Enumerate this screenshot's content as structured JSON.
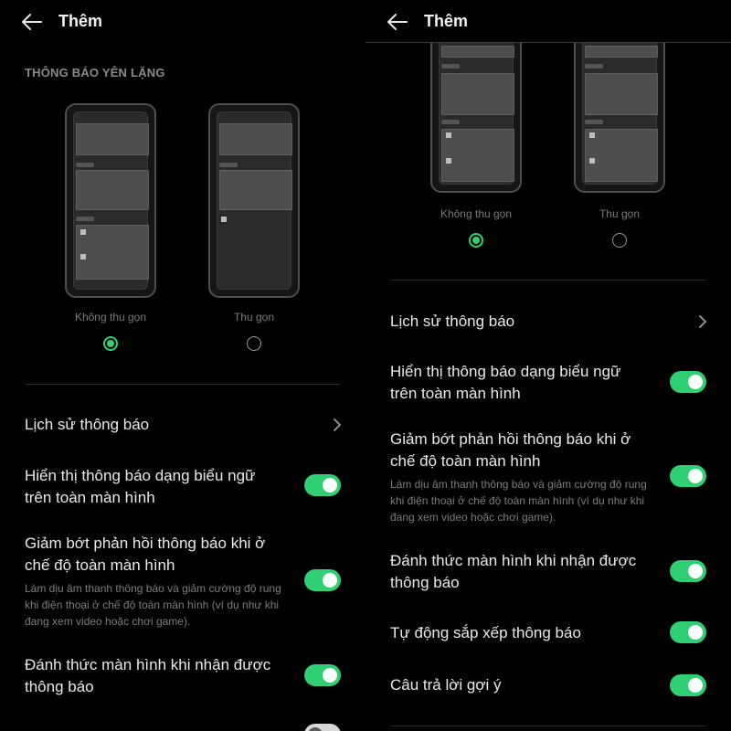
{
  "left": {
    "header": {
      "title": "Thêm"
    },
    "section_heading": "THÔNG BÁO YÊN LẶNG",
    "styles": [
      {
        "label": "Không thu gọn",
        "selected": true
      },
      {
        "label": "Thu gọn",
        "selected": false
      }
    ],
    "rows": [
      {
        "label": "Lịch sử thông báo",
        "control": "chevron"
      },
      {
        "label": "Hiển thị thông báo dạng biểu ngữ trên toàn màn hình",
        "control": "toggle",
        "on": true
      },
      {
        "label": "Giảm bớt phản hồi thông báo khi ở chế độ toàn màn hình",
        "sub": "Làm dịu âm thanh thông báo và giảm cường độ rung khi điện thoại ở chế độ toàn màn hình (ví dụ như khi đang xem video hoặc chơi game).",
        "control": "toggle",
        "on": true
      },
      {
        "label": "Đánh thức màn hình khi nhận được thông báo",
        "control": "toggle",
        "on": true
      }
    ]
  },
  "right": {
    "header": {
      "title": "Thêm"
    },
    "styles": [
      {
        "label": "Không thu gọn",
        "selected": true
      },
      {
        "label": "Thu gọn",
        "selected": false
      }
    ],
    "rows": [
      {
        "label": "Lịch sử thông báo",
        "control": "chevron"
      },
      {
        "label": "Hiển thị thông báo dạng biểu ngữ trên toàn màn hình",
        "control": "toggle",
        "on": true
      },
      {
        "label": "Giảm bớt phản hồi thông báo khi ở chế độ toàn màn hình",
        "sub": "Làm dịu âm thanh thông báo và giảm cường độ rung khi điện thoại ở chế độ toàn màn hình (ví dụ như khi đang xem video hoặc chơi game).",
        "control": "toggle",
        "on": true
      },
      {
        "label": "Đánh thức màn hình khi nhận được thông báo",
        "control": "toggle",
        "on": true
      },
      {
        "label": "Tự động sắp xếp thông báo",
        "control": "toggle",
        "on": true
      },
      {
        "label": "Câu trả lời gợi ý",
        "control": "toggle",
        "on": true
      }
    ]
  },
  "colors": {
    "accent": "#2fcf73",
    "background": "#000000",
    "text": "#e9e9e9",
    "muted": "#7c7c7c"
  },
  "icons": {
    "back": "arrow-left-icon",
    "chevron": "chevron-right-icon"
  }
}
